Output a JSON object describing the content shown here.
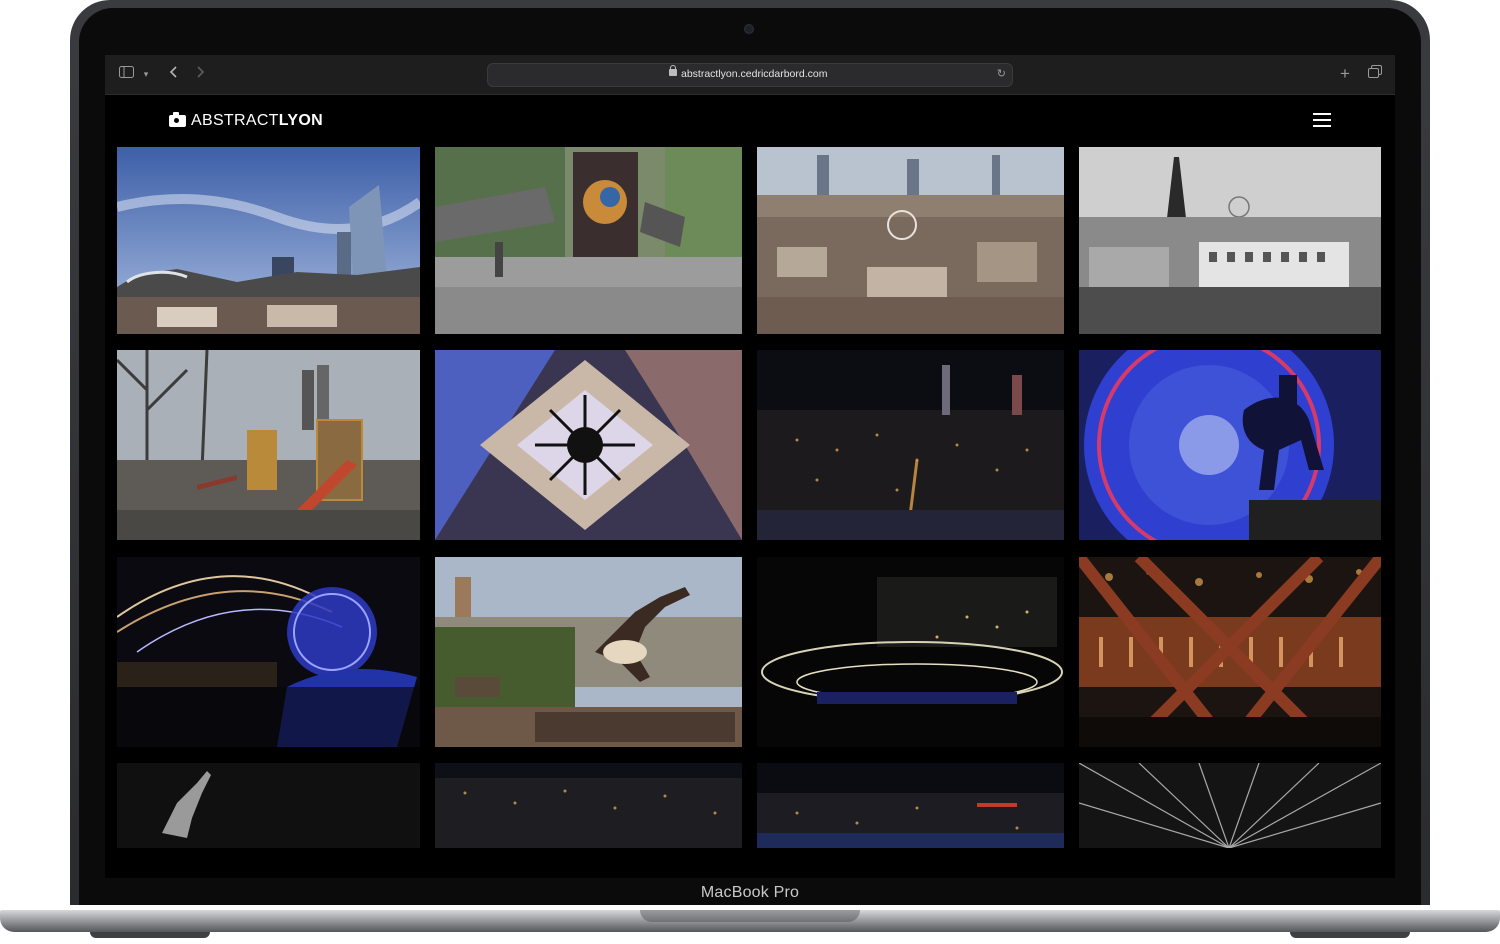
{
  "device": {
    "model_label": "MacBook Pro"
  },
  "browser": {
    "url": "abstractlyon.cedricdarbord.com",
    "icons": {
      "sidebar": "sidebar-icon",
      "chevron": "chevron-down-icon",
      "back": "back-arrow-icon",
      "forward": "forward-arrow-icon",
      "lock": "lock-icon",
      "reload": "reload-icon",
      "new_tab": "plus-icon",
      "tabs": "tab-overview-icon"
    }
  },
  "site": {
    "logo_light": "ABSTRACT",
    "logo_bold": "LYON",
    "menu_icon": "hamburger-menu-icon",
    "gallery": [
      {
        "name": "photo-lyon-skyline-tower"
      },
      {
        "name": "photo-bench-street-art"
      },
      {
        "name": "photo-city-panorama"
      },
      {
        "name": "photo-black-white-rooftops"
      },
      {
        "name": "photo-playground-winter"
      },
      {
        "name": "photo-courtyard-looking-up"
      },
      {
        "name": "photo-city-night-panorama"
      },
      {
        "name": "photo-equestrian-statue-blue-wheel"
      },
      {
        "name": "photo-light-trails-ferris-wheel"
      },
      {
        "name": "photo-breakdancer-terrace"
      },
      {
        "name": "photo-night-light-ring"
      },
      {
        "name": "photo-bridge-lights-bokeh"
      },
      {
        "name": "photo-dancer-dark"
      },
      {
        "name": "photo-city-lights-far"
      },
      {
        "name": "photo-river-night-lights"
      },
      {
        "name": "photo-zoom-burst-bw"
      }
    ]
  }
}
